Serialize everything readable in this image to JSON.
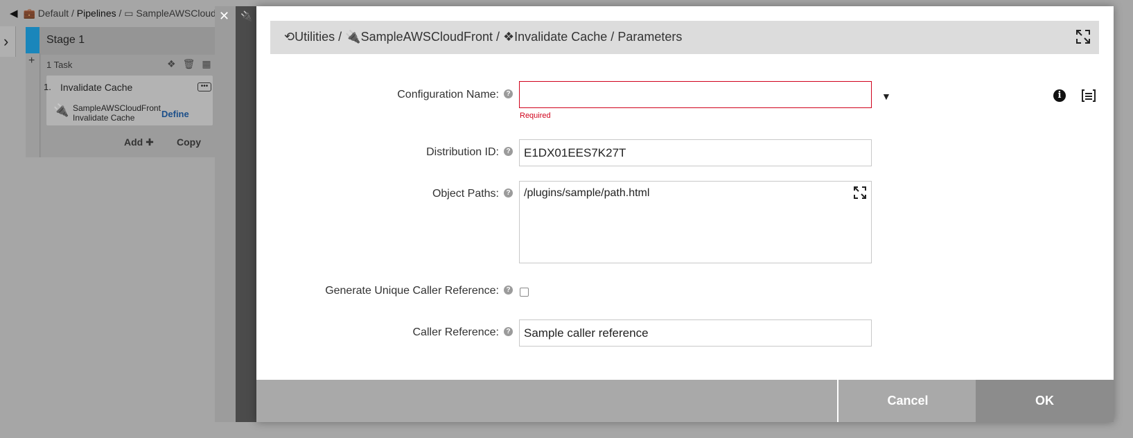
{
  "background": {
    "breadcrumb": {
      "parts": [
        "Default",
        "Pipelines",
        "SampleAWSCloud"
      ],
      "separator": "/"
    },
    "stage": {
      "title": "Stage 1",
      "task_count": "1 Task",
      "task_number": "1.",
      "task_name": "Invalidate Cache",
      "task_sub": "SampleAWSCloudFront Invalidate Cache",
      "define_label": "Define",
      "add_label": "Add",
      "copy_label": "Copy"
    }
  },
  "modal": {
    "breadcrumb": {
      "utilities": "Utilities",
      "plugin": "SampleAWSCloudFront",
      "procedure": "Invalidate Cache",
      "section": "Parameters",
      "separator": "/"
    },
    "fields": {
      "configuration_name": {
        "label": "Configuration Name:",
        "value": "",
        "error": "Required"
      },
      "distribution_id": {
        "label": "Distribution ID:",
        "value": "E1DX01EES7K27T"
      },
      "object_paths": {
        "label": "Object Paths:",
        "value": "/plugins/sample/path.html"
      },
      "generate_unique_caller_reference": {
        "label": "Generate Unique Caller Reference:",
        "checked": false
      },
      "caller_reference": {
        "label": "Caller Reference:",
        "value": "Sample caller reference"
      }
    },
    "buttons": {
      "cancel": "Cancel",
      "ok": "OK"
    }
  },
  "colors": {
    "accent_blue": "#1a86bb",
    "error_red": "#d0021b",
    "footer_gray": "#a9a9a9"
  }
}
